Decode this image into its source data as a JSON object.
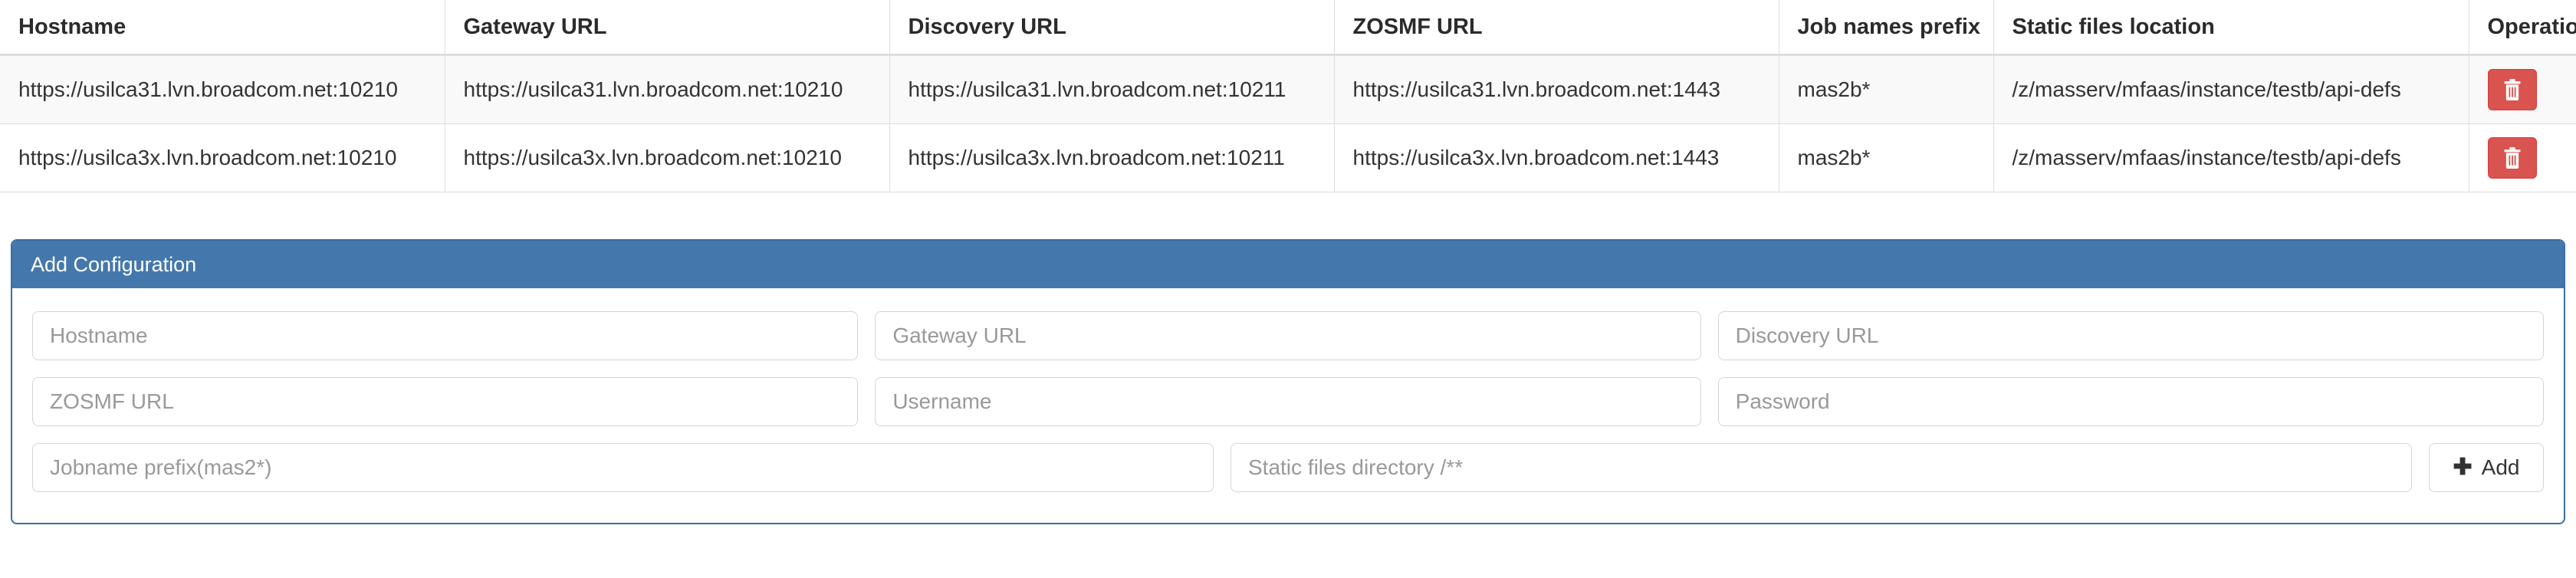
{
  "table": {
    "columns": [
      "Hostname",
      "Gateway URL",
      "Discovery URL",
      "ZOSMF URL",
      "Job names prefix",
      "Static files location",
      "Operations"
    ],
    "rows": [
      {
        "hostname": "https://usilca31.lvn.broadcom.net:10210",
        "gateway_url": "https://usilca31.lvn.broadcom.net:10210",
        "discovery_url": "https://usilca31.lvn.broadcom.net:10211",
        "zosmf_url": "https://usilca31.lvn.broadcom.net:1443",
        "job_names_prefix": "mas2b*",
        "static_files_location": "/z/masserv/mfaas/instance/testb/api-defs",
        "delete_icon": "trash-icon"
      },
      {
        "hostname": "https://usilca3x.lvn.broadcom.net:10210",
        "gateway_url": "https://usilca3x.lvn.broadcom.net:10210",
        "discovery_url": "https://usilca3x.lvn.broadcom.net:10211",
        "zosmf_url": "https://usilca3x.lvn.broadcom.net:1443",
        "job_names_prefix": "mas2b*",
        "static_files_location": "/z/masserv/mfaas/instance/testb/api-defs",
        "delete_icon": "trash-icon"
      }
    ]
  },
  "panel": {
    "title": "Add Configuration",
    "header_color": "#4478ad",
    "border_color": "#3a6ea5",
    "fields": {
      "hostname": {
        "placeholder": "Hostname",
        "value": ""
      },
      "gateway": {
        "placeholder": "Gateway URL",
        "value": ""
      },
      "discovery": {
        "placeholder": "Discovery URL",
        "value": ""
      },
      "zosmf": {
        "placeholder": "ZOSMF URL",
        "value": ""
      },
      "username": {
        "placeholder": "Username",
        "value": ""
      },
      "password": {
        "placeholder": "Password",
        "value": ""
      },
      "jobname": {
        "placeholder": "Jobname prefix(mas2*)",
        "value": ""
      },
      "staticdir": {
        "placeholder": "Static files directory /**",
        "value": ""
      }
    },
    "add_button": {
      "label": "Add",
      "icon": "plus-icon",
      "glyph": "✚"
    }
  },
  "colors": {
    "danger": "#d9534f",
    "panel_header": "#4478ad",
    "stripe": "#f9f9f9",
    "border": "#dddddd"
  }
}
